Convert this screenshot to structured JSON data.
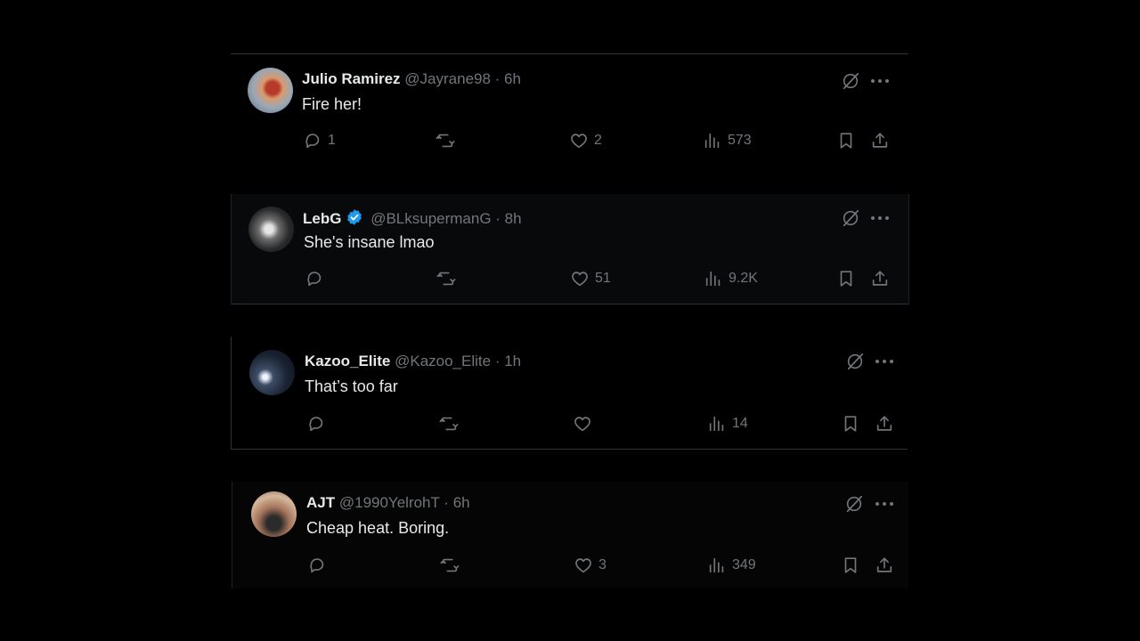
{
  "tweets": [
    {
      "name": "Julio Ramirez",
      "handle": "@Jayrane98",
      "time": "· 6h",
      "verified": false,
      "text": "Fire her!",
      "replies": "1",
      "retweets": "",
      "likes": "2",
      "views": "573"
    },
    {
      "name": "LebG",
      "handle": "@BLksupermanG",
      "time": "· 8h",
      "verified": true,
      "text": "She's insane lmao",
      "replies": "",
      "retweets": "",
      "likes": "51",
      "views": "9.2K"
    },
    {
      "name": "Kazoo_Elite",
      "handle": "@Kazoo_Elite",
      "time": "· 1h",
      "verified": false,
      "text": "That’s too far",
      "replies": "",
      "retweets": "",
      "likes": "",
      "views": "14"
    },
    {
      "name": "AJT",
      "handle": "@1990YelrohT",
      "time": "· 6h",
      "verified": false,
      "text": "Cheap heat. Boring.",
      "replies": "",
      "retweets": "",
      "likes": "3",
      "views": "349"
    }
  ],
  "icons": {
    "reply": "reply-icon",
    "retweet": "retweet-icon",
    "like": "heart-icon",
    "views": "views-icon",
    "bookmark": "bookmark-icon",
    "share": "share-icon",
    "grok": "grok-icon",
    "more": "more-icon",
    "verified": "verified-badge-icon"
  },
  "colors": {
    "background": "#000000",
    "text": "#e7e9ea",
    "muted": "#71767b",
    "verified": "#1d9bf0",
    "divider": "#2f3336"
  }
}
